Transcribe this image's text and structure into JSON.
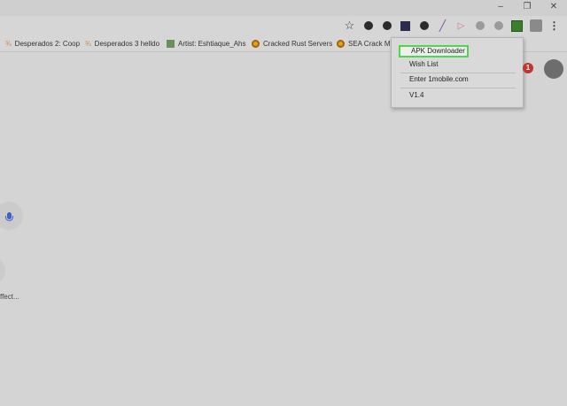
{
  "window": {
    "controls": {
      "minimize": "–",
      "maximize": "❐",
      "close": "✕"
    }
  },
  "toolbar": {
    "icons": [
      "star-icon",
      "cookie-icon",
      "steam-icon",
      "extension-icon",
      "circle-icon",
      "feather-icon",
      "play-icon",
      "grey-circle-icon",
      "grey-circle-icon",
      "power-icon",
      "avatar-icon",
      "kebab-icon"
    ]
  },
  "bookmarks": [
    {
      "label": "Desperados 2: Coop",
      "favicon": "desp"
    },
    {
      "label": "Desperados 3 helldo",
      "favicon": "desp"
    },
    {
      "label": "Artist: Eshtiaque_Ahs",
      "favicon": "art"
    },
    {
      "label": "Cracked Rust Servers",
      "favicon": "rust"
    },
    {
      "label": "SEA Crack Mak",
      "favicon": "rust"
    }
  ],
  "extension_menu": {
    "items": [
      {
        "label": "APK Downloader"
      },
      {
        "label": "Wish List"
      },
      {
        "label": "Enter 1mobile.com"
      },
      {
        "label": "V1.4"
      }
    ]
  },
  "notification": {
    "count": "1"
  },
  "shortcut": {
    "label": "ffect..."
  },
  "colors": {
    "highlight": "#4bd84b",
    "badge": "#c8312c"
  }
}
